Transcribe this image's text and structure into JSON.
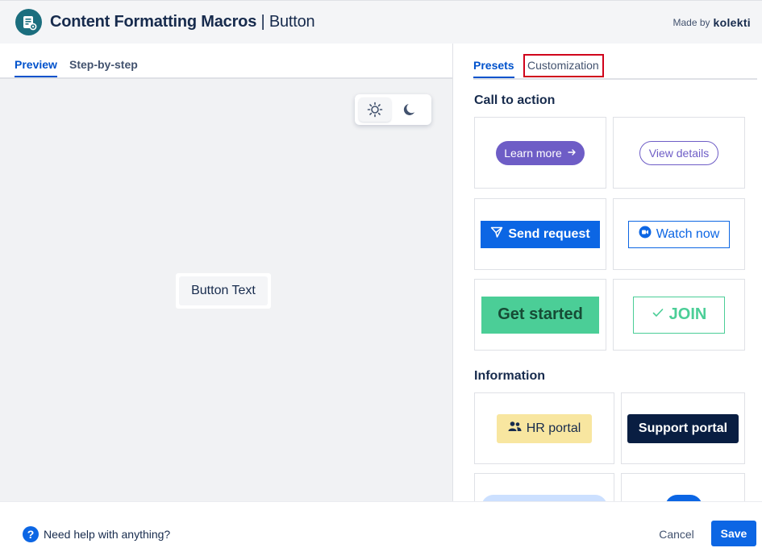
{
  "header": {
    "title": "Content Formatting Macros",
    "separator": " | ",
    "subtitle": "Button",
    "made_by_label": "Made by",
    "brand": "kolekti",
    "logo_icon": "document-gear-icon"
  },
  "left_tabs": [
    {
      "label": "Preview",
      "active": true
    },
    {
      "label": "Step-by-step",
      "active": false
    }
  ],
  "theme_toggle": {
    "light_icon": "sun-icon",
    "dark_icon": "moon-icon",
    "selected": "light"
  },
  "preview": {
    "button_text": "Button Text"
  },
  "right_tabs": [
    {
      "label": "Presets",
      "active": true
    },
    {
      "label": "Customization",
      "active": false,
      "highlighted": true
    }
  ],
  "sections": {
    "call_to_action": "Call to action",
    "information": "Information"
  },
  "presets": {
    "learn_more": {
      "label": "Learn more",
      "icon": "arrow-right-icon"
    },
    "view_details": {
      "label": "View details"
    },
    "send_request": {
      "label": "Send request",
      "icon": "send-icon"
    },
    "watch_now": {
      "label": "Watch now",
      "icon": "video-camera-icon"
    },
    "get_started": {
      "label": "Get started"
    },
    "join": {
      "label": "JOIN",
      "icon": "check-icon"
    },
    "hr_portal": {
      "label": "HR portal",
      "icon": "people-icon"
    },
    "support_portal": {
      "label": "Support portal"
    }
  },
  "colors": {
    "primary": "#0c66e4",
    "purple": "#6e5dc6",
    "green": "#4bce97",
    "yellow": "#f8e6a0",
    "navy": "#091e42",
    "highlight_box": "#d0021b"
  },
  "footer": {
    "help_icon": "question-circle-icon",
    "help_text": "Need help with anything?",
    "cancel_label": "Cancel",
    "save_label": "Save"
  }
}
